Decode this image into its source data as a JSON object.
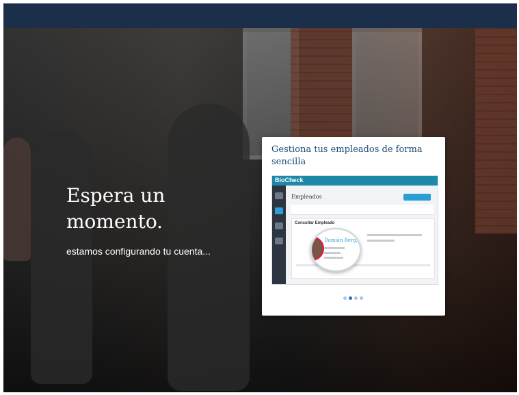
{
  "header": {},
  "hero": {
    "title": "Espera un momento.",
    "subtitle": "estamos configurando tu cuenta..."
  },
  "card": {
    "title": "Gestiona tus empleados de forma sencilla",
    "screenshot": {
      "logo": "BioCheck",
      "heading": "Empleados",
      "panel_title": "Consultar Empleado",
      "employee_name": "Damián Berg, Ben Hidalgo"
    },
    "carousel": {
      "count": 4,
      "active_index": 1
    }
  },
  "colors": {
    "topbar": "#1b2f4a",
    "card_title": "#1b4b73",
    "accent": "#1e88a8",
    "dot_active": "#2a6fb8",
    "dot_inactive": "#a9c4e4"
  }
}
